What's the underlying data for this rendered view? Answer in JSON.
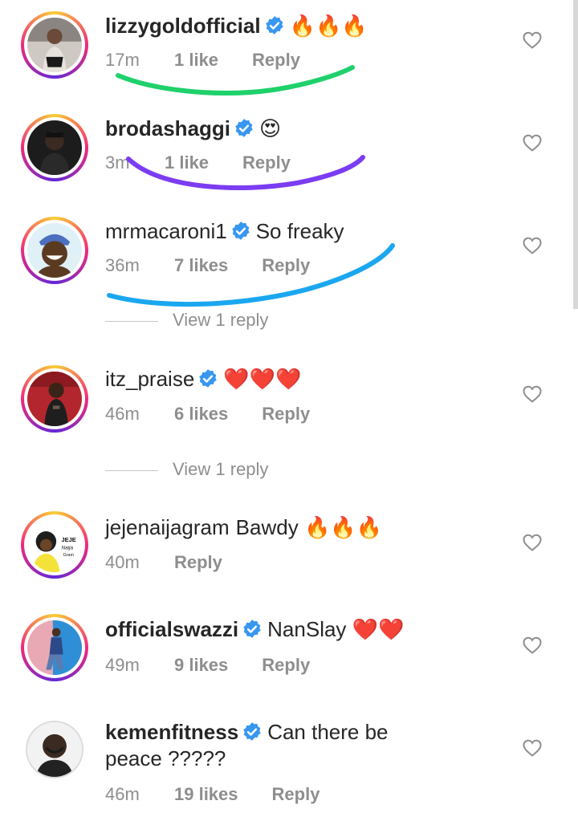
{
  "comments": [
    {
      "username": "lizzygoldofficial",
      "verified": true,
      "text": "",
      "emoji": "🔥🔥🔥",
      "time": "17m",
      "likes": "1 like",
      "reply": "Reply",
      "has_story_ring": true
    },
    {
      "username": "brodashaggi",
      "verified": true,
      "text": "",
      "emoji": "😍",
      "time": "3m",
      "likes": "1 like",
      "reply": "Reply",
      "has_story_ring": true
    },
    {
      "username": "mrmacaroni1",
      "verified": true,
      "text": "So freaky",
      "emoji": "",
      "time": "36m",
      "likes": "7 likes",
      "reply": "Reply",
      "has_story_ring": true,
      "view_replies": "View 1 reply"
    },
    {
      "username": "itz_praise",
      "verified": true,
      "text": "",
      "emoji": "❤️❤️❤️",
      "time": "46m",
      "likes": "6 likes",
      "reply": "Reply",
      "has_story_ring": true,
      "view_replies": "View 1 reply"
    },
    {
      "username": "jejenaijagram",
      "verified": false,
      "text": "Bawdy",
      "emoji": "🔥🔥🔥",
      "time": "40m",
      "likes": "",
      "reply": "Reply",
      "has_story_ring": true,
      "avatar_text": "JEJE Naija Gram"
    },
    {
      "username": "officialswazzi",
      "verified": true,
      "text": "NanSlay",
      "emoji": "❤️❤️",
      "time": "49m",
      "likes": "9 likes",
      "reply": "Reply",
      "has_story_ring": true
    },
    {
      "username": "kemenfitness",
      "verified": true,
      "text": "Can there be",
      "text_line2": "peace ?????",
      "emoji": "",
      "time": "46m",
      "likes": "19 likes",
      "reply": "Reply",
      "has_story_ring": false
    }
  ],
  "icons": {
    "like": "heart-outline-icon",
    "verified": "verified-badge-icon"
  },
  "colors": {
    "verified_blue": "#3897f0",
    "scribble_green": "#1fd16b",
    "scribble_purple": "#7b3cf2",
    "scribble_blue": "#1aa7f0",
    "meta_gray": "#8e8e8e",
    "text_dark": "#262626"
  }
}
